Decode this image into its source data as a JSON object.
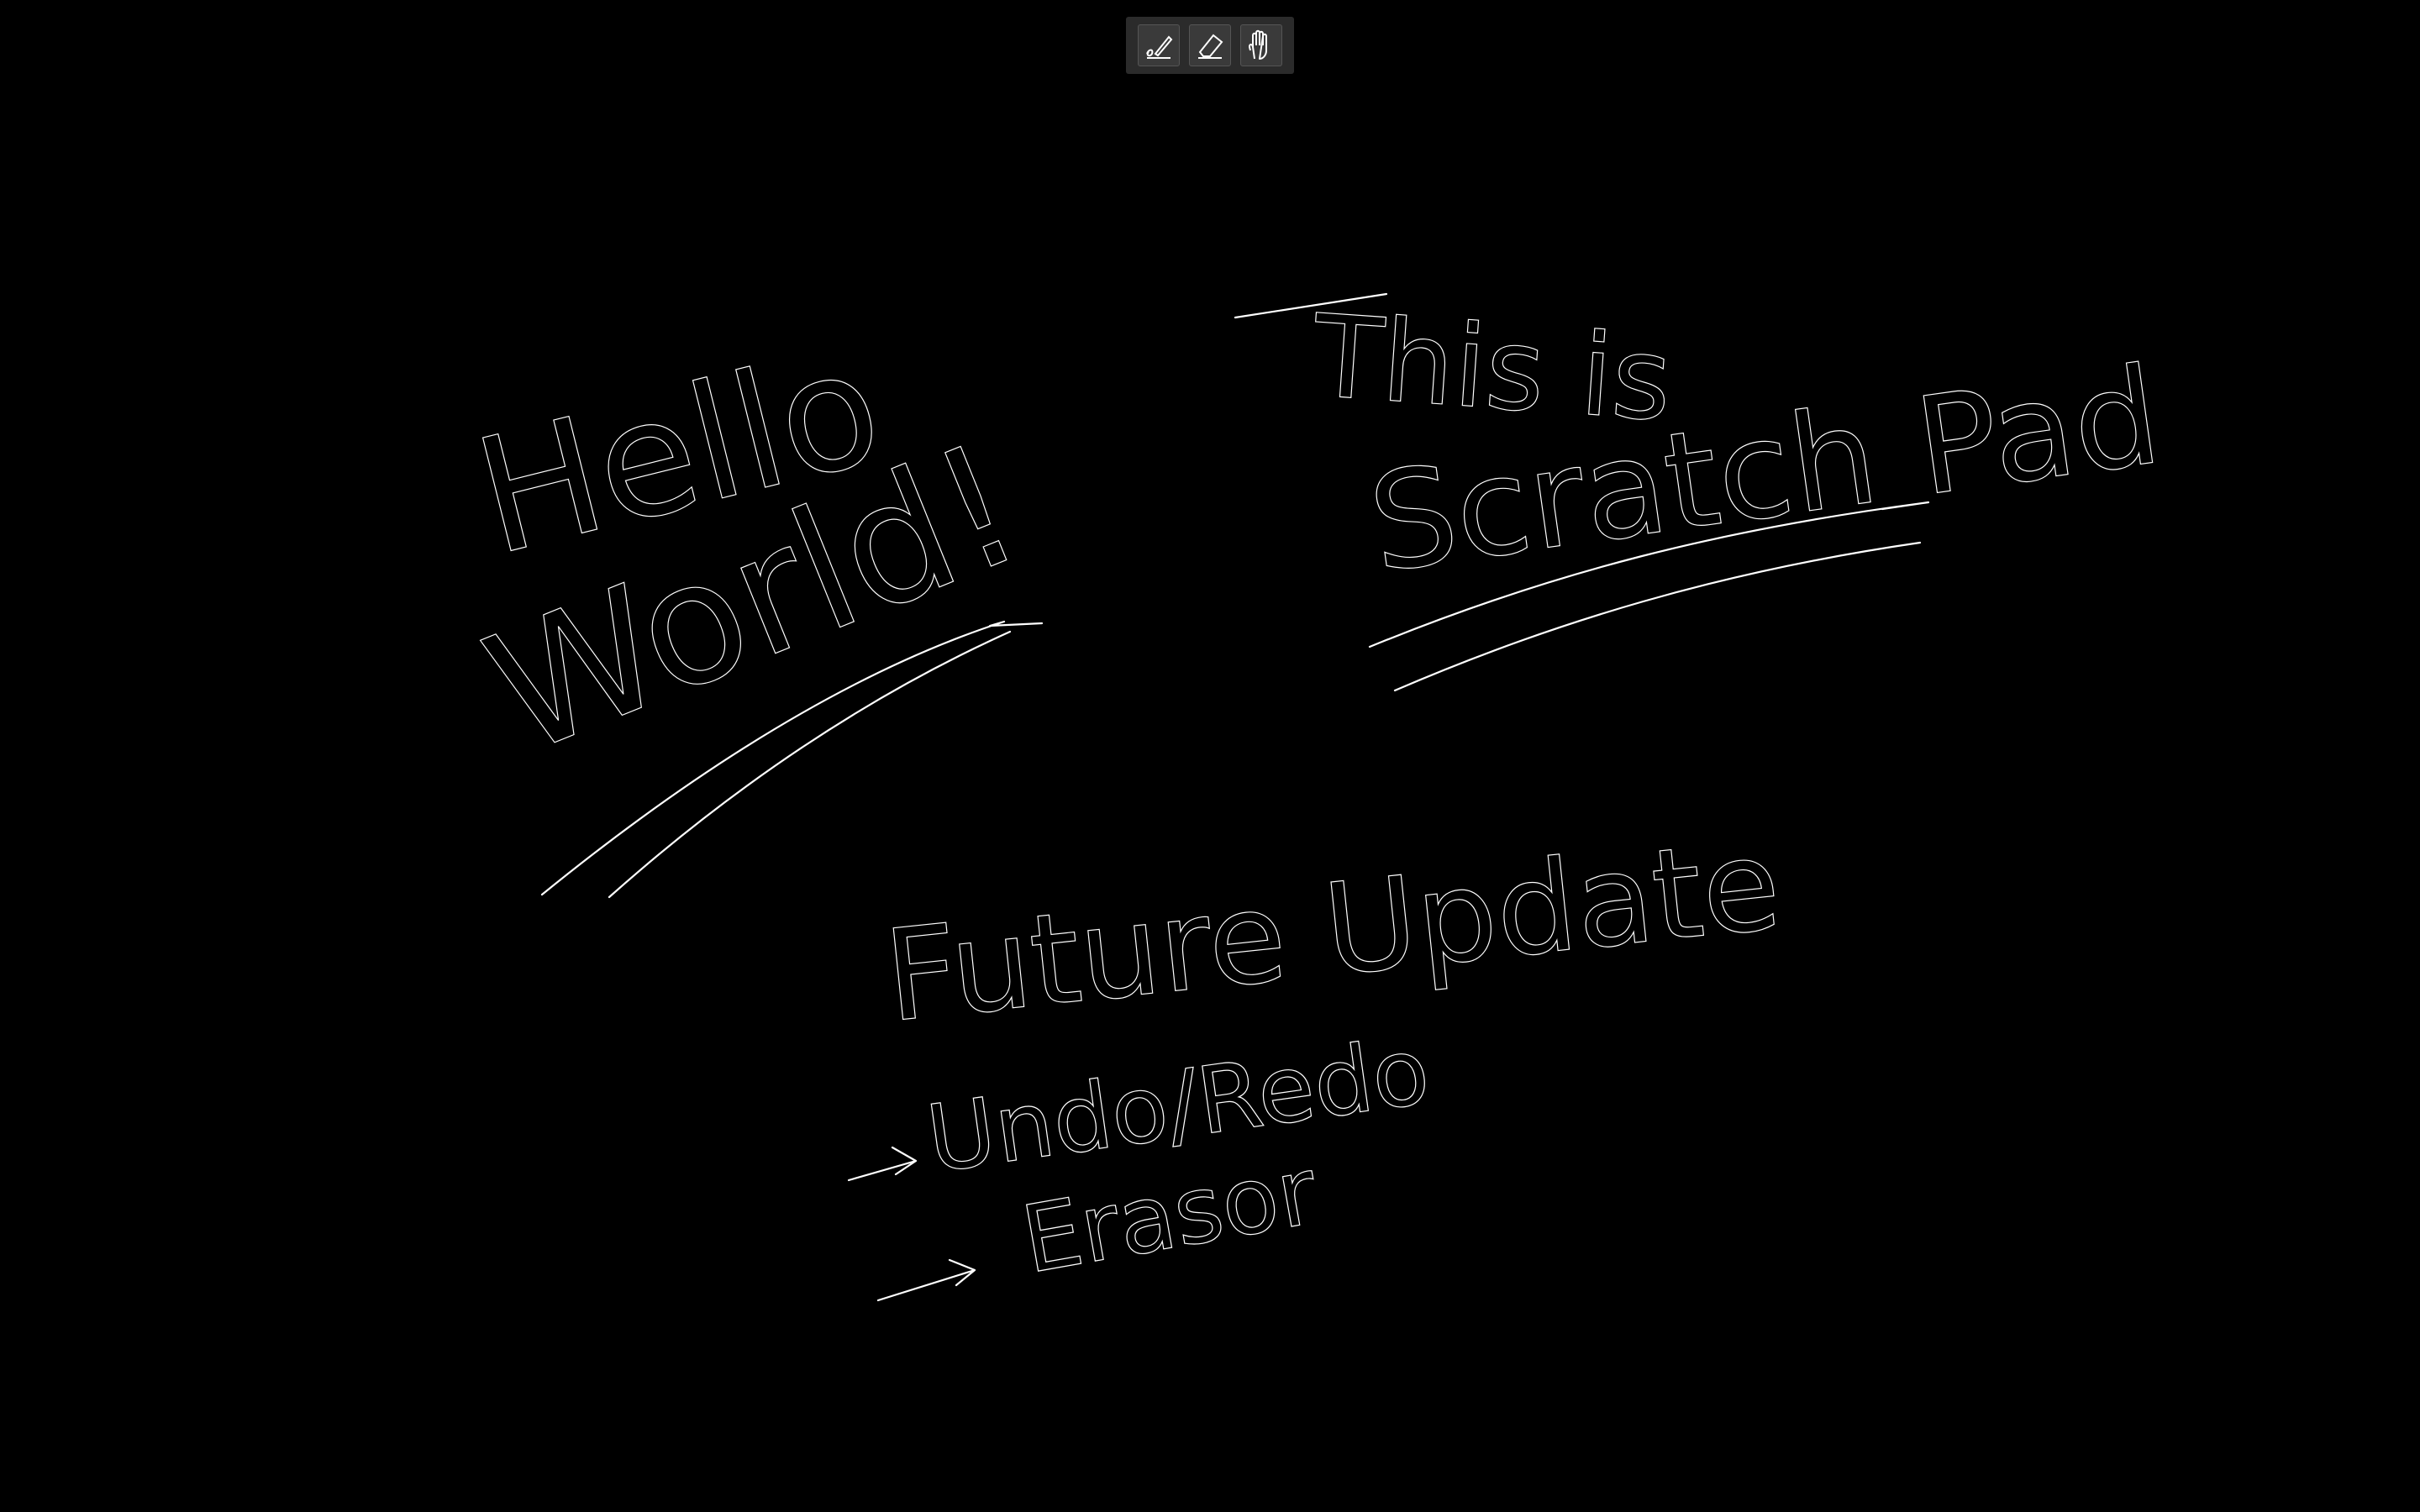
{
  "app": {
    "background_color": "#000000",
    "ink_color": "#ffffff"
  },
  "toolbar": {
    "tools": [
      {
        "name": "pen",
        "icon": "pen-icon"
      },
      {
        "name": "eraser",
        "icon": "eraser-icon"
      },
      {
        "name": "pan",
        "icon": "hand-icon"
      }
    ]
  },
  "canvas": {
    "handwriting": {
      "hello": "Hello",
      "world": "World!",
      "this_is": "This is",
      "scratch_pad": "Scratch Pad",
      "future_update": "Future Update",
      "undo_redo": "Undo/Redo",
      "erasor": "Erasor"
    }
  }
}
